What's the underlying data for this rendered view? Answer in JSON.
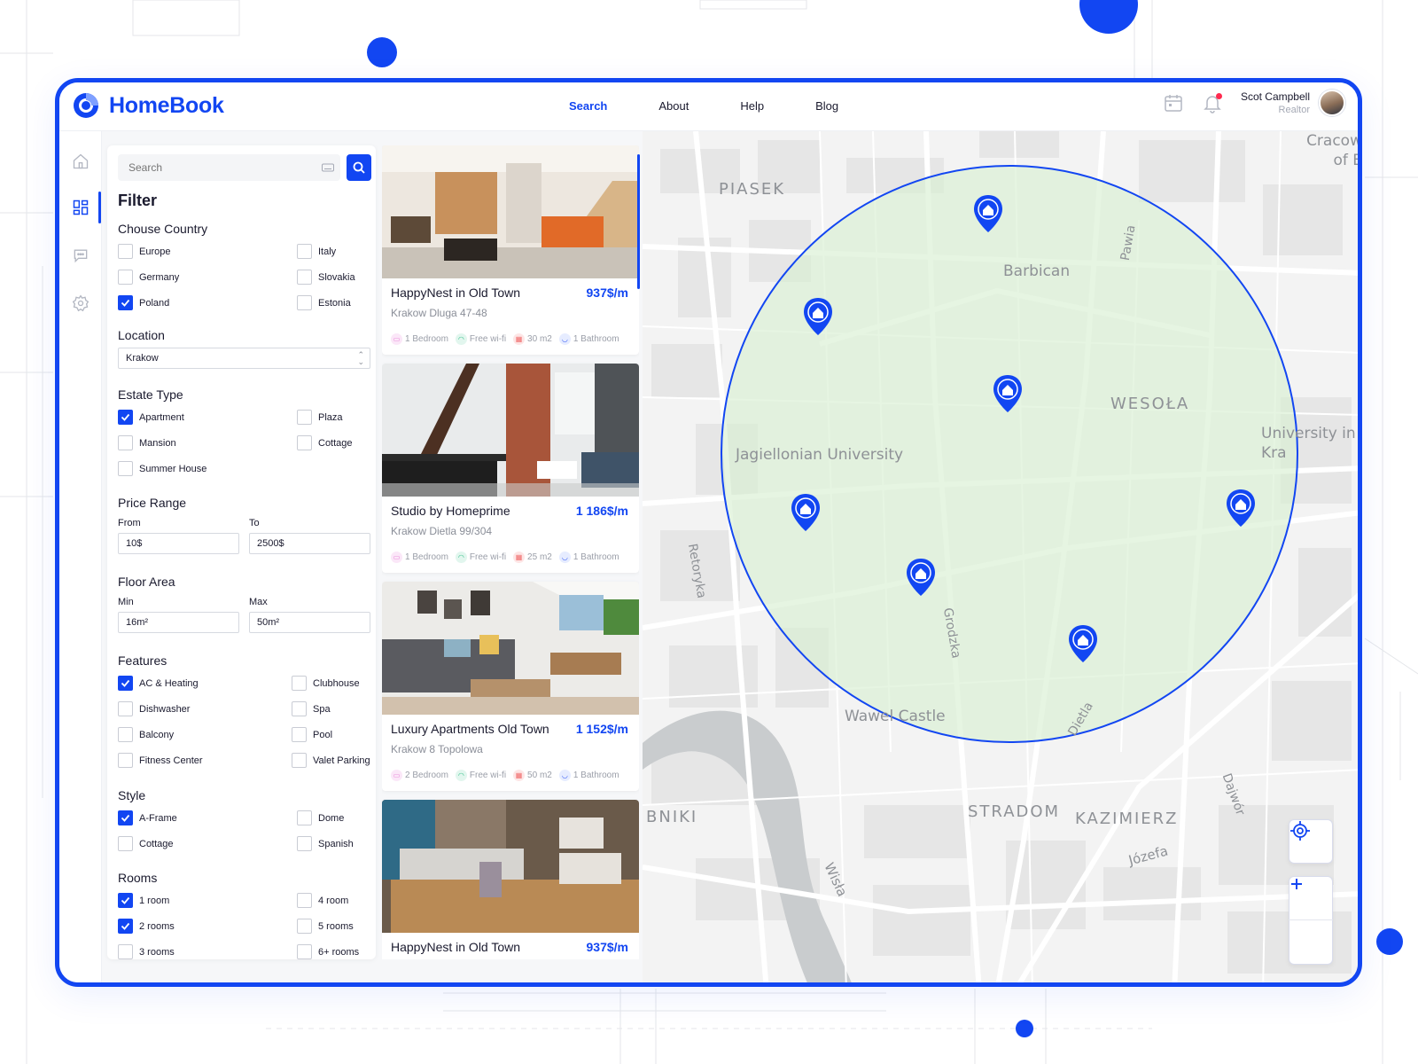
{
  "app": {
    "name": "HomeBook",
    "brand_color": "#1246f2"
  },
  "nav": [
    {
      "label": "Search",
      "active": true
    },
    {
      "label": "About",
      "active": false
    },
    {
      "label": "Help",
      "active": false
    },
    {
      "label": "Blog",
      "active": false
    }
  ],
  "user": {
    "name": "Scot Campbell",
    "role": "Realtor",
    "has_notification": true
  },
  "rail": [
    "home-icon",
    "dashboard-icon",
    "chat-icon",
    "settings-icon"
  ],
  "search": {
    "placeholder": "Search"
  },
  "filter": {
    "title": "Filter",
    "country": {
      "title": "Chouse Country",
      "options": [
        {
          "label": "Europe",
          "checked": false
        },
        {
          "label": "Italy",
          "checked": false
        },
        {
          "label": "Germany",
          "checked": false
        },
        {
          "label": "Slovakia",
          "checked": false
        },
        {
          "label": "Poland",
          "checked": true
        },
        {
          "label": "Estonia",
          "checked": false
        }
      ]
    },
    "location": {
      "title": "Location",
      "value": "Krakow"
    },
    "estate_type": {
      "title": "Estate Type",
      "options": [
        {
          "label": "Apartment",
          "checked": true
        },
        {
          "label": "Plaza",
          "checked": false
        },
        {
          "label": "Mansion",
          "checked": false
        },
        {
          "label": "Cottage",
          "checked": false
        },
        {
          "label": "Summer House",
          "checked": false
        }
      ]
    },
    "price_range": {
      "title": "Price Range",
      "from_label": "From",
      "to_label": "To",
      "from": "10$",
      "to": "2500$"
    },
    "floor_area": {
      "title": "Floor Area",
      "min_label": "Min",
      "max_label": "Max",
      "min": "16m²",
      "max": "50m²"
    },
    "features": {
      "title": "Features",
      "options": [
        {
          "label": "AC & Heating",
          "checked": true
        },
        {
          "label": "Clubhouse",
          "checked": false
        },
        {
          "label": "Dishwasher",
          "checked": false
        },
        {
          "label": "Spa",
          "checked": false
        },
        {
          "label": "Balcony",
          "checked": false
        },
        {
          "label": "Pool",
          "checked": false
        },
        {
          "label": "Fitness Center",
          "checked": false
        },
        {
          "label": "Valet Parking",
          "checked": false
        }
      ]
    },
    "style": {
      "title": "Style",
      "options": [
        {
          "label": "A-Frame",
          "checked": true
        },
        {
          "label": "Dome",
          "checked": false
        },
        {
          "label": "Cottage",
          "checked": false
        },
        {
          "label": "Spanish",
          "checked": false
        }
      ]
    },
    "rooms": {
      "title": "Rooms",
      "options": [
        {
          "label": "1 room",
          "checked": true
        },
        {
          "label": "4 room",
          "checked": false
        },
        {
          "label": "2 rooms",
          "checked": true
        },
        {
          "label": "5 rooms",
          "checked": false
        },
        {
          "label": "3 rooms",
          "checked": false
        },
        {
          "label": "6+ rooms",
          "checked": false
        }
      ]
    }
  },
  "listings": [
    {
      "title": "HappyNest in Old Town",
      "price": "937$/m",
      "address": "Krakow Dluga 47-48",
      "amenities": [
        "1 Bedroom",
        "Free wi-fi",
        "30 m2",
        "1 Bathroom"
      ]
    },
    {
      "title": "Studio by Homeprime",
      "price": "1 186$/m",
      "address": "Krakow Dietla 99/304",
      "amenities": [
        "1 Bedroom",
        "Free wi-fi",
        "25 m2",
        "1 Bathroom"
      ]
    },
    {
      "title": "Luxury Apartments Old Town",
      "price": "1 152$/m",
      "address": "Krakow 8 Topolowa",
      "amenities": [
        "2 Bedroom",
        "Free wi-fi",
        "50 m2",
        "1 Bathroom"
      ]
    },
    {
      "title": "HappyNest in Old Town",
      "price": "937$/m",
      "address": "",
      "amenities": []
    }
  ],
  "amenity_icons": [
    "bed-icon",
    "wifi-icon",
    "area-icon",
    "bath-icon"
  ],
  "amenity_colors": [
    "#e77fd6",
    "#2fbf86",
    "#f06a6a",
    "#4a6cf7"
  ],
  "map": {
    "labels": [
      "PIASEK",
      "Barbican",
      "Pawia",
      "WESOŁA",
      "Jagiellonian University",
      "University in Kra",
      "Retoryka",
      "Grodzka",
      "Wawel Castle",
      "Dietla",
      "STRADOM",
      "KAZIMIERZ",
      "Dajwór",
      "Józefa",
      "Wisła",
      "BNIKI",
      "Cracow of E"
    ],
    "search_radius_color": "#dff0dc",
    "pins": 7,
    "controls": [
      "locate-icon",
      "zoom-in-icon",
      "zoom-out-icon"
    ]
  }
}
